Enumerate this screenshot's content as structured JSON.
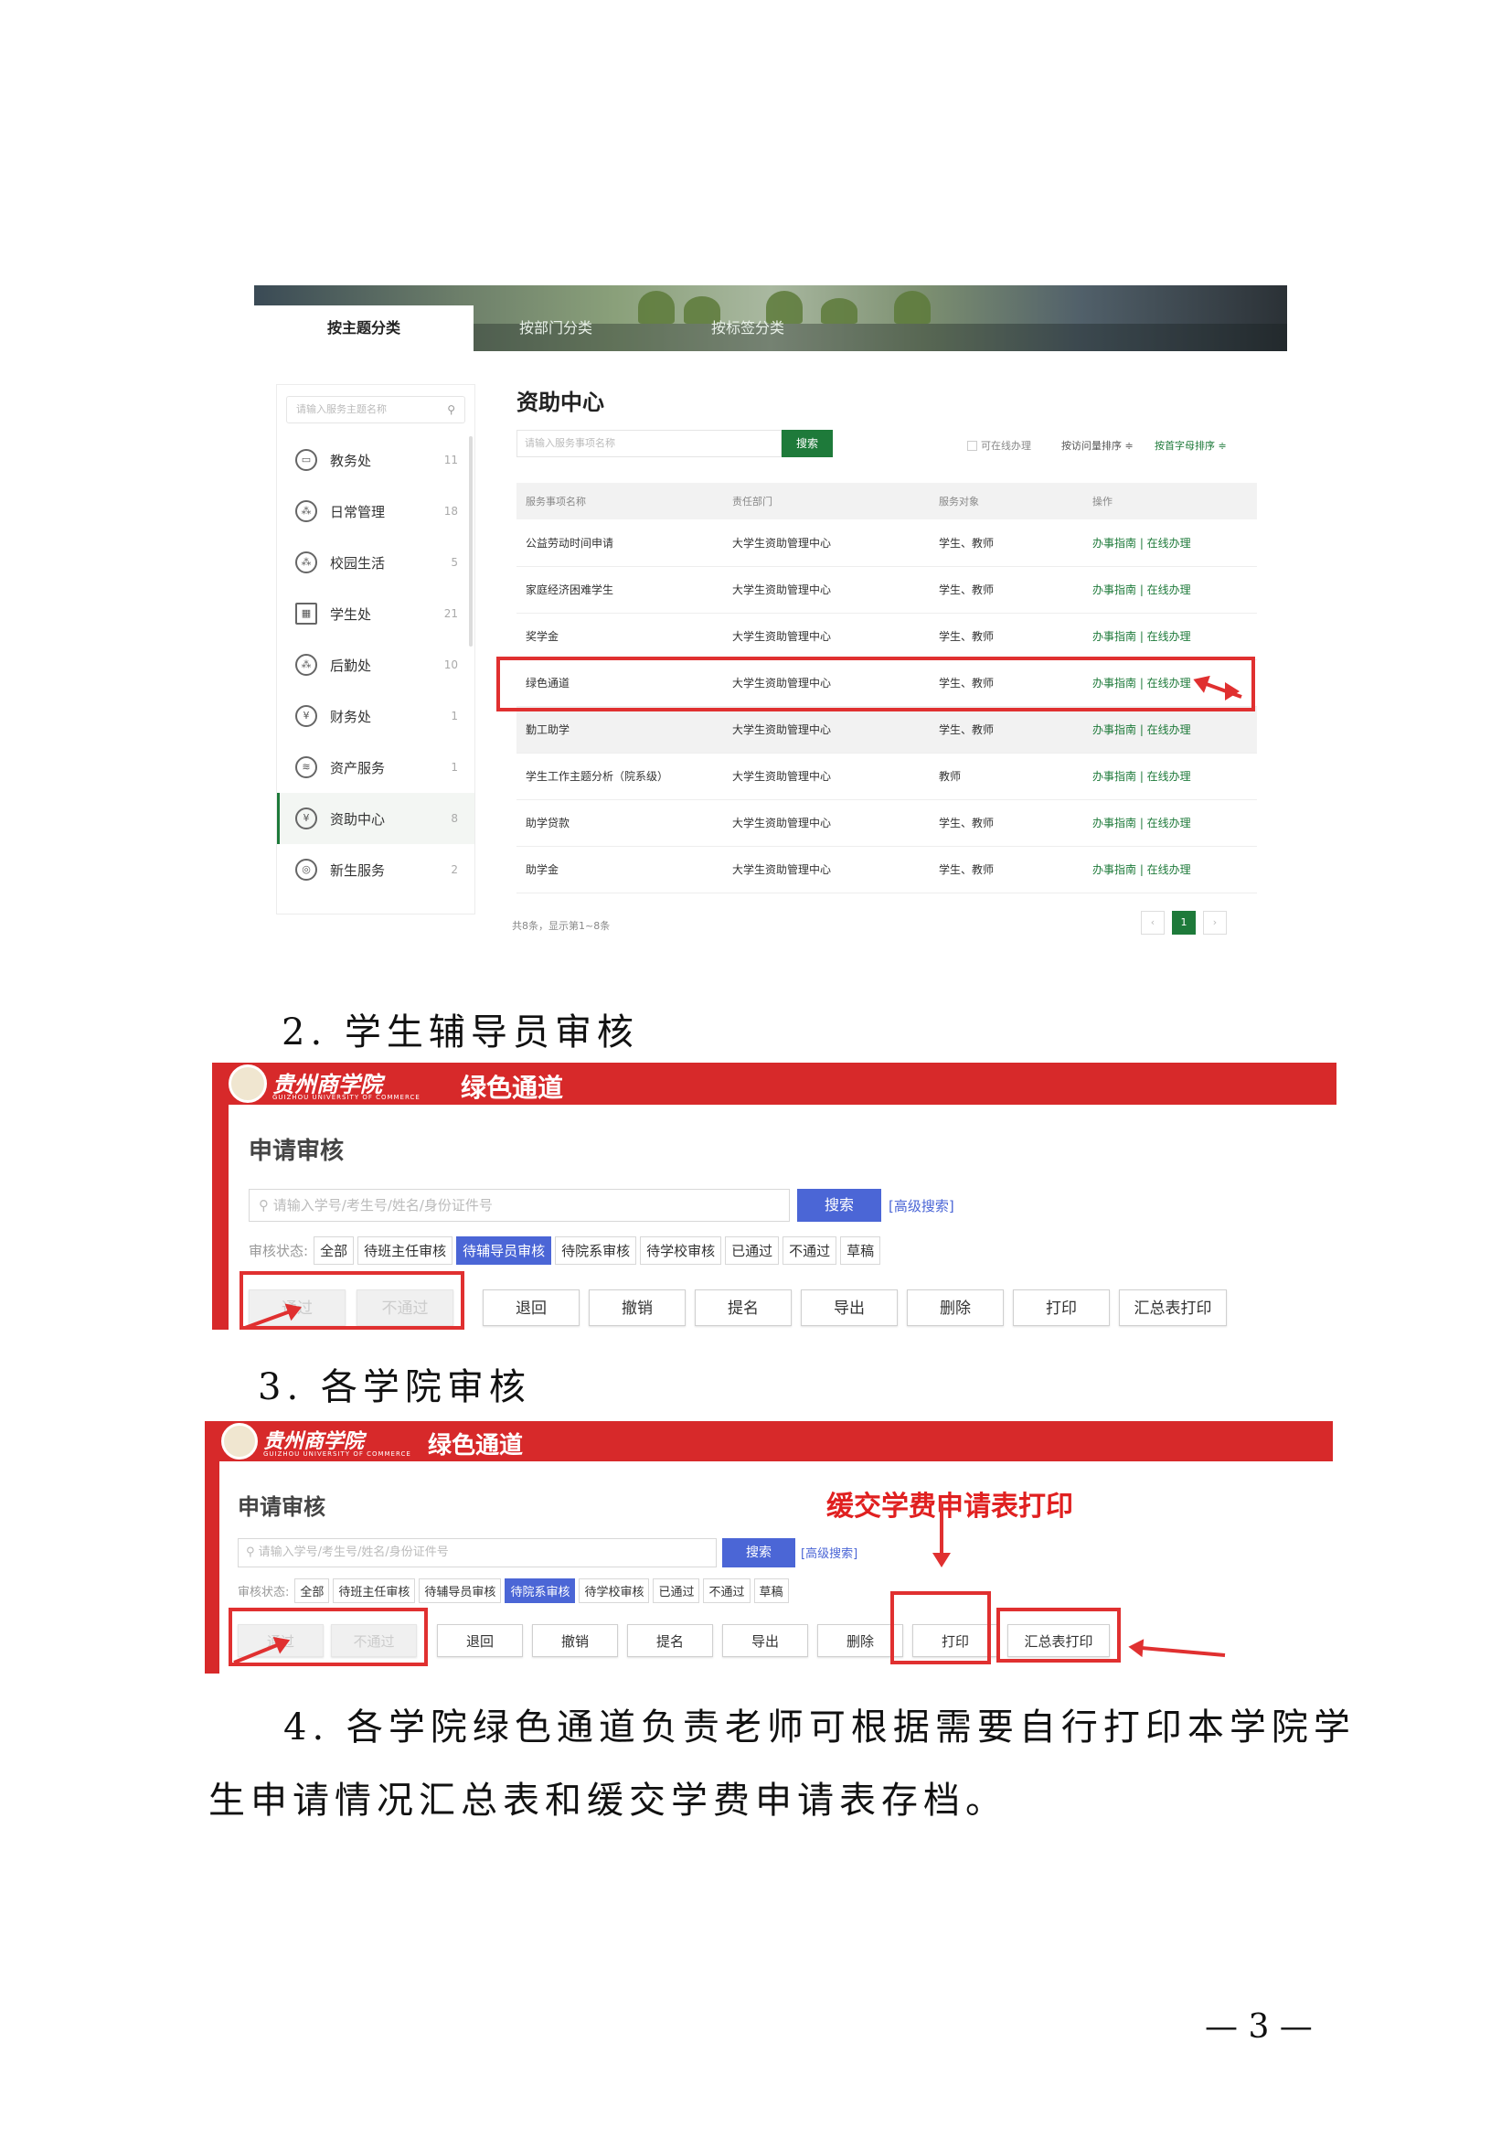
{
  "shot1": {
    "tabs": [
      "按主题分类",
      "按部门分类",
      "按标签分类"
    ],
    "sidebar_search_placeholder": "请输入服务主题名称",
    "sidebar_items": [
      {
        "label": "教务处",
        "count": "11",
        "icon": "board-icon"
      },
      {
        "label": "日常管理",
        "count": "18",
        "icon": "network-icon"
      },
      {
        "label": "校园生活",
        "count": "5",
        "icon": "network-icon"
      },
      {
        "label": "学生处",
        "count": "21",
        "icon": "grid-icon"
      },
      {
        "label": "后勤处",
        "count": "10",
        "icon": "network-icon"
      },
      {
        "label": "财务处",
        "count": "1",
        "icon": "money-bag-icon"
      },
      {
        "label": "资产服务",
        "count": "1",
        "icon": "layers-icon"
      },
      {
        "label": "资助中心",
        "count": "8",
        "icon": "money-bag-icon"
      },
      {
        "label": "新生服务",
        "count": "2",
        "icon": "fingerprint-icon"
      }
    ],
    "main_title": "资助中心",
    "search_placeholder": "请输入服务事项名称",
    "search_button": "搜索",
    "online_checkbox": "可在线办理",
    "sort_visits": "按访问量排序 ≑",
    "sort_alpha": "按首字母排序 ≑",
    "columns": [
      "服务事项名称",
      "责任部门",
      "服务对象",
      "操作"
    ],
    "rows": [
      {
        "name": "公益劳动时间申请",
        "dept": "大学生资助管理中心",
        "target": "学生、教师",
        "ops": "办事指南 | 在线办理"
      },
      {
        "name": "家庭经济困难学生",
        "dept": "大学生资助管理中心",
        "target": "学生、教师",
        "ops": "办事指南 | 在线办理"
      },
      {
        "name": "奖学金",
        "dept": "大学生资助管理中心",
        "target": "学生、教师",
        "ops": "办事指南 | 在线办理"
      },
      {
        "name": "绿色通道",
        "dept": "大学生资助管理中心",
        "target": "学生、教师",
        "ops": "办事指南 | 在线办理"
      },
      {
        "name": "勤工助学",
        "dept": "大学生资助管理中心",
        "target": "学生、教师",
        "ops": "办事指南 | 在线办理"
      },
      {
        "name": "学生工作主题分析（院系级）",
        "dept": "大学生资助管理中心",
        "target": "教师",
        "ops": "办事指南 | 在线办理"
      },
      {
        "name": "助学贷款",
        "dept": "大学生资助管理中心",
        "target": "学生、教师",
        "ops": "办事指南 | 在线办理"
      },
      {
        "name": "助学金",
        "dept": "大学生资助管理中心",
        "target": "学生、教师",
        "ops": "办事指南 | 在线办理"
      }
    ],
    "footer_count": "共8条，显示第1~8条",
    "pager": [
      "‹",
      "1",
      "›"
    ]
  },
  "heading2": "2. 学生辅导员审核",
  "heading3": "3. 各学院审核",
  "shot2": {
    "logo": "贵州商学院",
    "logo_sub": "GUIZHOU UNIVERSITY OF COMMERCE",
    "app_title": "绿色通道",
    "section_title": "申请审核",
    "search_placeholder": "请输入学号/考生号/姓名/身份证件号",
    "search_button": "搜索",
    "advanced": "[高级搜索]",
    "status_label": "审核状态:",
    "status_chips": [
      "全部",
      "待班主任审核",
      "待辅导员审核",
      "待院系审核",
      "待学校审核",
      "已通过",
      "不通过",
      "草稿"
    ],
    "active_chip": "待辅导员审核",
    "actions": [
      "通过",
      "不通过",
      "退回",
      "撤销",
      "提名",
      "导出",
      "删除",
      "打印",
      "汇总表打印"
    ]
  },
  "shot3": {
    "logo": "贵州商学院",
    "logo_sub": "GUIZHOU UNIVERSITY OF COMMERCE",
    "app_title": "绿色通道",
    "section_title": "申请审核",
    "annotation": "缓交学费申请表打印",
    "search_placeholder": "请输入学号/考生号/姓名/身份证件号",
    "search_button": "搜索",
    "advanced": "[高级搜索]",
    "status_label": "审核状态:",
    "status_chips": [
      "全部",
      "待班主任审核",
      "待辅导员审核",
      "待院系审核",
      "待学校审核",
      "已通过",
      "不通过",
      "草稿"
    ],
    "active_chip": "待院系审核",
    "actions": [
      "通过",
      "不通过",
      "退回",
      "撤销",
      "提名",
      "导出",
      "删除",
      "打印",
      "汇总表打印"
    ]
  },
  "paragraph4_line1": "4. 各学院绿色通道负责老师可根据需要自行打印本学院学",
  "paragraph4_line2": "生申请情况汇总表和缓交学费申请表存档。",
  "page_number": "— 3 —",
  "colors": {
    "accent_green": "#1e7a3a",
    "brand_red": "#d7292a",
    "action_blue": "#4b66d6",
    "annotation_red": "#e03030"
  }
}
